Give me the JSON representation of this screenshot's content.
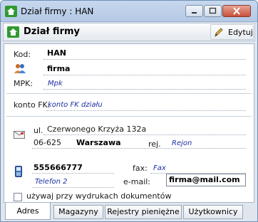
{
  "window": {
    "title": "Dział firmy : HAN"
  },
  "header": {
    "title": "Dział firmy",
    "edit_label": "Edytuj"
  },
  "fields": {
    "kod_label": "Kod:",
    "kod_value": "HAN",
    "firma_value": "firma",
    "mpk_label": "MPK:",
    "mpk_value": "Mpk",
    "konto_label": "konto FK:",
    "konto_value": "konto FK działu",
    "ul_label": "ul.",
    "street_value": "Czerwonego Krzyża 132a",
    "postal_code": "06-625",
    "city": "Warszawa",
    "rej_label": "rej.",
    "rej_value": "Rejon",
    "phone": "555666777",
    "phone2": "Telefon 2",
    "fax_label": "fax:",
    "fax_value": "Fax",
    "email_label": "e-mail:",
    "email_value": "firma@mail.com"
  },
  "checkbox": {
    "label": "używaj przy wydrukach dokumentów"
  },
  "tabs": [
    {
      "label": "Adres"
    },
    {
      "label": "Magazyny"
    },
    {
      "label": "Rejestry pieniężne"
    },
    {
      "label": "Użytkownicy"
    }
  ]
}
